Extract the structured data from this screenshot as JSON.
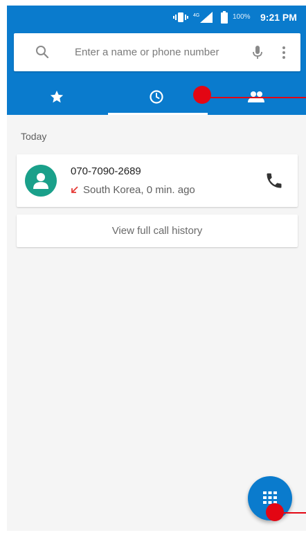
{
  "status_bar": {
    "battery_percent": "100%",
    "time": "9:21 PM"
  },
  "search": {
    "placeholder": "Enter a name or phone number",
    "value": ""
  },
  "tabs": [
    {
      "icon": "star-icon",
      "name": "speed-dial",
      "selected": false
    },
    {
      "icon": "clock-icon",
      "name": "recents",
      "selected": true
    },
    {
      "icon": "people-icon",
      "name": "contacts",
      "selected": false
    }
  ],
  "recents": {
    "section_title": "Today",
    "calls": [
      {
        "number": "070-7090-2689",
        "type_icon": "missed-call-icon",
        "detail": "South Korea, 0 min. ago"
      }
    ],
    "view_history_label": "View full call history"
  },
  "fab": {
    "icon": "dialpad-icon"
  },
  "colors": {
    "primary": "#0a7bcd",
    "avatar": "#1aa08a",
    "missed_call": "#e53935",
    "annotation": "#e30613",
    "background": "#f5f5f5"
  }
}
